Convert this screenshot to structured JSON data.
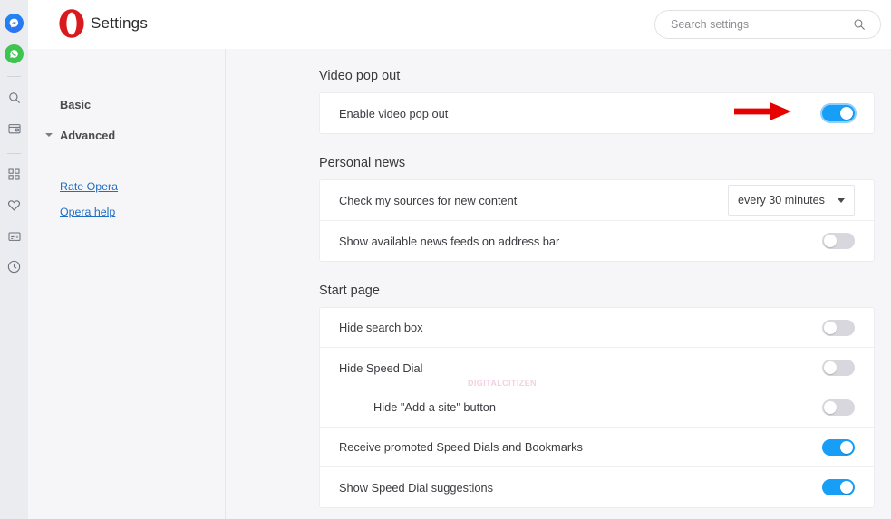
{
  "window": {
    "title": "Settings",
    "logo_icon": "opera-logo",
    "accent_blue": "#179ef7",
    "link_blue": "#1f6fc4",
    "opera_red": "#d8191f",
    "annotation_red": "#e60000"
  },
  "rail": {
    "items": [
      {
        "name": "messenger",
        "icon": "messenger-icon"
      },
      {
        "name": "whatsapp",
        "icon": "whatsapp-icon"
      },
      {
        "name": "divider-1",
        "icon": "divider"
      },
      {
        "name": "search",
        "icon": "search-icon"
      },
      {
        "name": "crypto-wallet",
        "icon": "wallet-icon"
      },
      {
        "name": "divider-2",
        "icon": "divider"
      },
      {
        "name": "speed-dial",
        "icon": "grid-icon"
      },
      {
        "name": "bookmarks",
        "icon": "heart-icon"
      },
      {
        "name": "personal-news",
        "icon": "news-icon"
      },
      {
        "name": "history",
        "icon": "clock-icon"
      }
    ]
  },
  "search": {
    "placeholder": "Search settings",
    "value": "",
    "icon": "search-icon"
  },
  "nav": {
    "basic_label": "Basic",
    "advanced_label": "Advanced",
    "advanced_expanded_icon": "chevron-down-icon",
    "links": [
      {
        "label": "Rate Opera"
      },
      {
        "label": "Opera help"
      }
    ]
  },
  "sections": [
    {
      "title": "Video pop out",
      "rows": [
        {
          "label": "Enable video pop out",
          "control": "toggle",
          "state": "on",
          "focused": true,
          "annotated": true
        }
      ]
    },
    {
      "title": "Personal news",
      "rows": [
        {
          "label": "Check my sources for new content",
          "control": "select",
          "value": "every 30 minutes"
        },
        {
          "label": "Show available news feeds on address bar",
          "control": "toggle",
          "state": "off"
        }
      ]
    },
    {
      "title": "Start page",
      "rows": [
        {
          "label": "Hide search box",
          "control": "toggle",
          "state": "off"
        },
        {
          "label": "Hide Speed Dial",
          "control": "toggle",
          "state": "off"
        },
        {
          "label": "Hide \"Add a site\" button",
          "control": "toggle",
          "state": "off",
          "indent": true
        },
        {
          "label": "Receive promoted Speed Dials and Bookmarks",
          "control": "toggle",
          "state": "on"
        },
        {
          "label": "Show Speed Dial suggestions",
          "control": "toggle",
          "state": "on"
        }
      ]
    }
  ],
  "watermark": {
    "text": "DIGITALCITIZEN"
  }
}
